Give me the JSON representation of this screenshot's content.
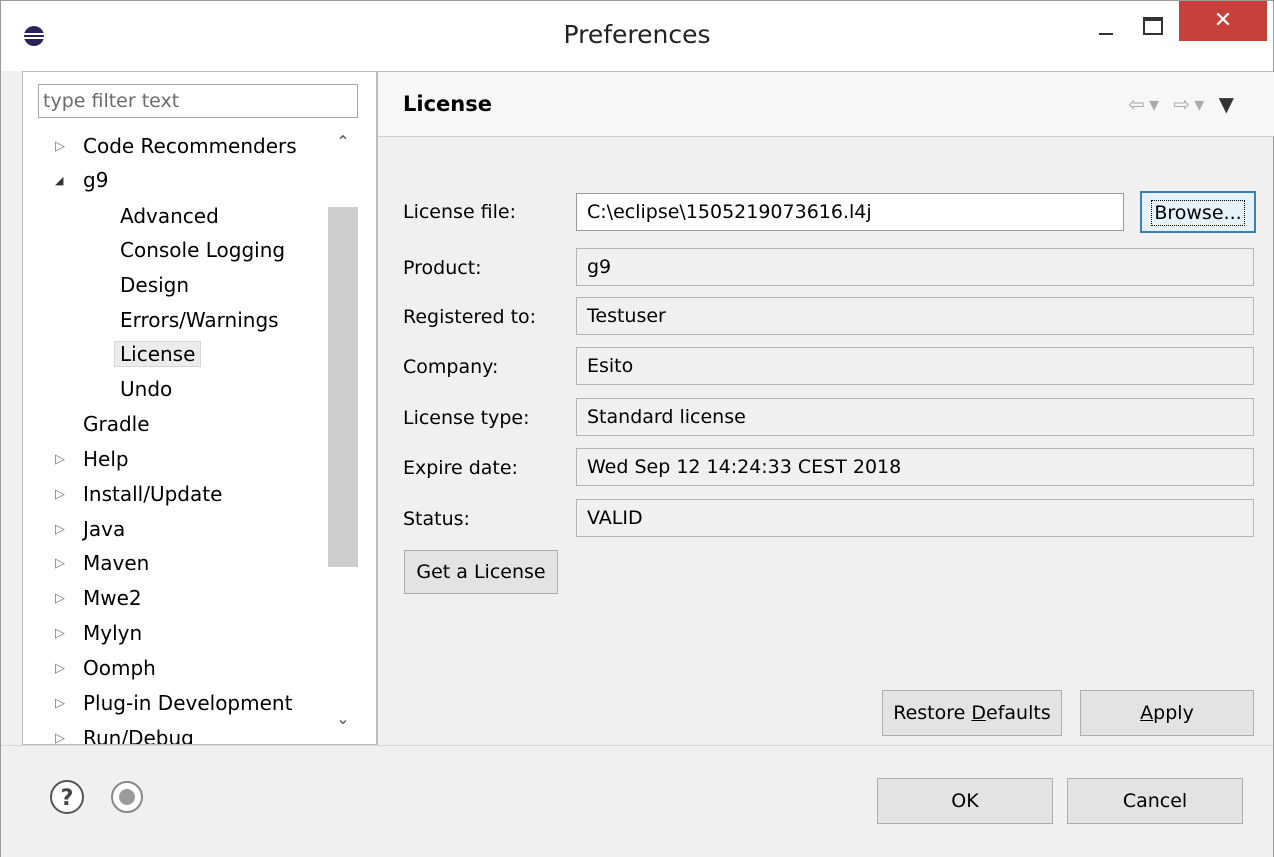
{
  "window": {
    "title": "Preferences",
    "close_glyph": "✕",
    "icons": {
      "app": "eclipse-icon",
      "minimize": "minimize-icon",
      "maximize": "maximize-icon",
      "close": "close-icon"
    },
    "close_color": "#c7403a"
  },
  "sidebar": {
    "filter_placeholder": "type filter text",
    "items": [
      {
        "label": "Code Recommenders",
        "arrow": "▷"
      },
      {
        "label": "g9",
        "arrow": "◢"
      },
      {
        "label": "Advanced"
      },
      {
        "label": "Console Logging"
      },
      {
        "label": "Design"
      },
      {
        "label": "Errors/Warnings"
      },
      {
        "label": "License",
        "selected": true
      },
      {
        "label": "Undo"
      },
      {
        "label": "Gradle"
      },
      {
        "label": "Help",
        "arrow": "▷"
      },
      {
        "label": "Install/Update",
        "arrow": "▷"
      },
      {
        "label": "Java",
        "arrow": "▷"
      },
      {
        "label": "Maven",
        "arrow": "▷"
      },
      {
        "label": "Mwe2",
        "arrow": "▷"
      },
      {
        "label": "Mylyn",
        "arrow": "▷"
      },
      {
        "label": "Oomph",
        "arrow": "▷"
      },
      {
        "label": "Plug-in Development",
        "arrow": "▷"
      },
      {
        "label": "Run/Debug",
        "arrow": "▷"
      }
    ],
    "scroll_up_glyph": "⌃",
    "scroll_down_glyph": "⌄"
  },
  "page": {
    "title": "License",
    "nav": {
      "back": "⇦",
      "back_menu": "▾",
      "forward": "⇨",
      "forward_menu": "▾",
      "view_menu": "▼"
    },
    "fields": {
      "license_file": {
        "label": "License file:",
        "value": "C:\\eclipse\\1505219073616.l4j"
      },
      "product": {
        "label": "Product:",
        "value": "g9"
      },
      "registered_to": {
        "label": "Registered to:",
        "value": "Testuser"
      },
      "company": {
        "label": "Company:",
        "value": "Esito"
      },
      "license_type": {
        "label": "License type:",
        "value": "Standard license"
      },
      "expire_date": {
        "label": "Expire date:",
        "value": "Wed Sep 12 14:24:33 CEST 2018"
      },
      "status": {
        "label": "Status:",
        "value": "VALID"
      }
    },
    "browse_label": "Browse...",
    "get_license_label": "Get a License",
    "restore_prefix": "Restore ",
    "restore_mnemonic": "D",
    "restore_suffix": "efaults",
    "apply_mnemonic": "A",
    "apply_suffix": "pply"
  },
  "footer": {
    "ok_label": "OK",
    "cancel_label": "Cancel",
    "icons": {
      "help": "help-icon",
      "record": "record-icon"
    }
  }
}
